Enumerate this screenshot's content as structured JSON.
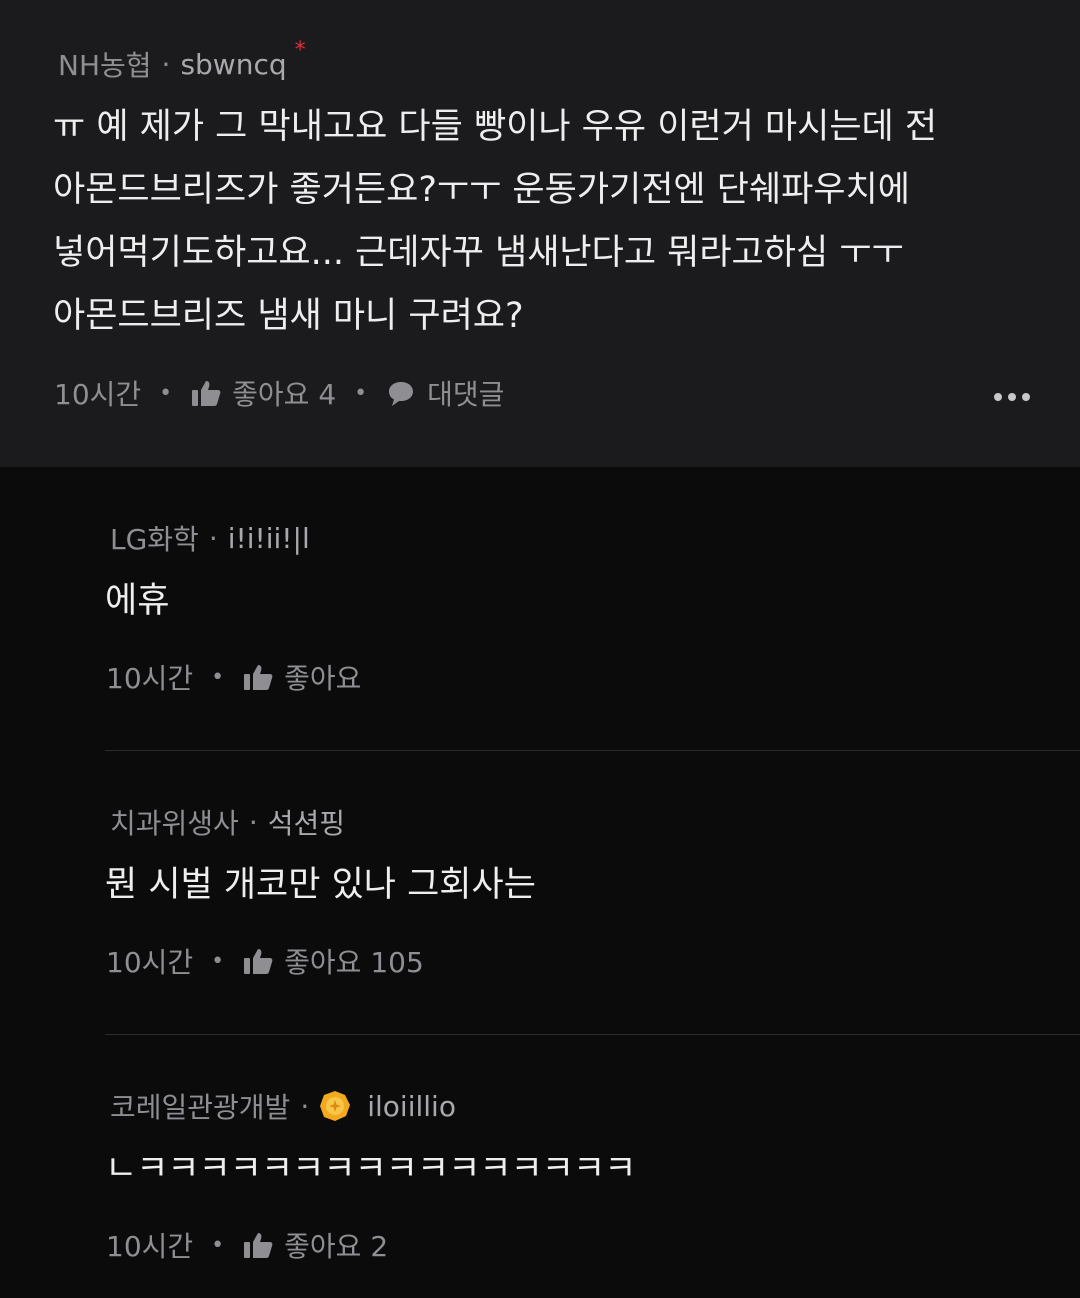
{
  "main_comment": {
    "company": "NH농협",
    "nickname": "sbwncq",
    "author_marker": "*",
    "text": "ㅠ 예 제가 그 막내고요 다들 빵이나 우유 이런거 마시는데 전\n아몬드브리즈가 좋거든요?ㅜㅜ 운동가기전엔 단쉐파우치에\n넣어먹기도하고요... 근데자꾸 냄새난다고 뭐라고하심 ㅜㅜ\n아몬드브리즈 냄새 마니 구려요?",
    "time": "10시간",
    "like_label": "좋아요 4",
    "reply_label": "대댓글"
  },
  "replies": [
    {
      "company": "LG화학",
      "nickname": "i!i!ii!|l",
      "text": "에휴",
      "time": "10시간",
      "like_label": "좋아요"
    },
    {
      "company": "치과위생사",
      "nickname": "석션핑",
      "text": "뭔 시벌 개코만 있나 그회사는",
      "time": "10시간",
      "like_label": "좋아요 105"
    },
    {
      "company": "코레일관광개발",
      "nickname": "iloiillio",
      "badge_icon": "gold-badge-icon",
      "text": "ㄴㅋㅋㅋㅋㅋㅋㅋㅋㅋㅋㅋㅋㅋㅋㅋㅋ",
      "time": "10시간",
      "like_label": "좋아요 2"
    }
  ],
  "colors": {
    "background": "#0b0b0c",
    "main_comment_bg": "#1b1b1d",
    "meta_text": "#8e8e93",
    "body_text": "#eeeeee",
    "author_marker": "#e0303c",
    "badge": "#f2a91e"
  }
}
